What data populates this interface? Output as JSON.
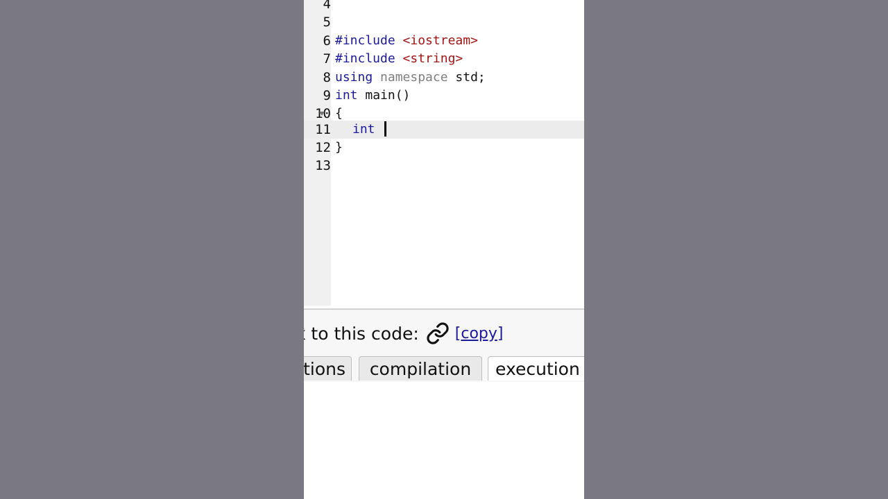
{
  "editor": {
    "lines": [
      {
        "number": "4"
      },
      {
        "number": "5"
      },
      {
        "number": "6",
        "tokens": {
          "kw": "#include",
          "inc": "<iostream>"
        }
      },
      {
        "number": "7",
        "tokens": {
          "kw": "#include",
          "inc": "<string>"
        }
      },
      {
        "number": "8",
        "tokens": {
          "kw": "using",
          "ns": "namespace",
          "rest": "std;"
        }
      },
      {
        "number": "9",
        "tokens": {
          "kw": "int",
          "rest": "main()"
        }
      },
      {
        "number": "10",
        "tokens": {
          "rest": "{"
        }
      },
      {
        "number": "11",
        "tokens": {
          "kw": "int"
        }
      },
      {
        "number": "12",
        "tokens": {
          "rest": "}"
        }
      },
      {
        "number": "13"
      }
    ]
  },
  "share": {
    "label": "k to this code:",
    "link_icon": "link-icon",
    "copy_open": "[",
    "copy_text": "copy",
    "copy_close": "]"
  },
  "tabs": {
    "options": "tions",
    "compilation": "compilation",
    "execution": "execution"
  },
  "colors": {
    "background": "#7a7983",
    "keyword": "#1a1a9a",
    "include": "#a31515",
    "namespace": "#7f7f7f"
  }
}
